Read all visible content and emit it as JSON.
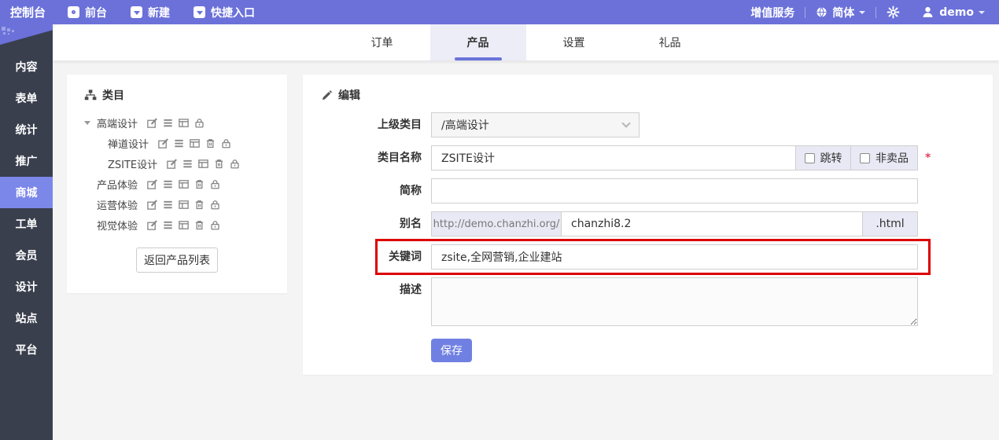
{
  "topbar": {
    "logo": "控制台",
    "nav": [
      {
        "label": "前台",
        "icon": "monitor-icon"
      },
      {
        "label": "新建",
        "icon": "caret-square-icon"
      },
      {
        "label": "快捷入口",
        "icon": "caret-square-icon"
      }
    ],
    "vas": "增值服务",
    "language": "简体",
    "username": "demo"
  },
  "sidebar": {
    "items": [
      {
        "label": "内容"
      },
      {
        "label": "表单"
      },
      {
        "label": "统计"
      },
      {
        "label": "推广"
      },
      {
        "label": "商城",
        "active": true
      },
      {
        "label": "工单"
      },
      {
        "label": "会员"
      },
      {
        "label": "设计"
      },
      {
        "label": "站点"
      },
      {
        "label": "平台"
      }
    ]
  },
  "tabs": {
    "items": [
      {
        "label": "订单"
      },
      {
        "label": "产品",
        "active": true
      },
      {
        "label": "设置"
      },
      {
        "label": "礼品"
      }
    ]
  },
  "category_panel": {
    "title": "类目",
    "back_button": "返回产品列表",
    "tree": [
      {
        "name": "高端设计",
        "level": 0,
        "expanded": true,
        "actions": [
          "edit",
          "list",
          "browse",
          "lock"
        ]
      },
      {
        "name": "禅道设计",
        "level": 1,
        "actions": [
          "edit",
          "list",
          "browse",
          "delete",
          "lock"
        ]
      },
      {
        "name": "ZSITE设计",
        "level": 1,
        "actions": [
          "edit",
          "list",
          "browse",
          "delete",
          "lock"
        ]
      },
      {
        "name": "产品体验",
        "level": 0,
        "actions": [
          "edit",
          "list",
          "browse",
          "delete",
          "lock"
        ]
      },
      {
        "name": "运营体验",
        "level": 0,
        "actions": [
          "edit",
          "list",
          "browse",
          "delete",
          "lock"
        ]
      },
      {
        "name": "视觉体验",
        "level": 0,
        "actions": [
          "edit",
          "list",
          "browse",
          "delete",
          "lock"
        ]
      }
    ]
  },
  "edit_panel": {
    "title": "编辑",
    "save_label": "保存",
    "fields": {
      "parent": {
        "label": "上级类目",
        "value": "/高端设计"
      },
      "name": {
        "label": "类目名称",
        "value": "ZSITE设计",
        "checkbox_redirect": "跳转",
        "checkbox_notforsale": "非卖品",
        "required_mark": "*"
      },
      "shortname": {
        "label": "简称",
        "value": ""
      },
      "alias": {
        "label": "别名",
        "prefix": "http://demo.chanzhi.org/",
        "value": "chanzhi8.2",
        "suffix": ".html"
      },
      "keywords": {
        "label": "关键词",
        "value": "zsite,全网营销,企业建站",
        "highlighted": true
      },
      "description": {
        "label": "描述",
        "value": ""
      }
    }
  },
  "colors": {
    "accent": "#6b71d9",
    "sidebar_bg": "#3a3f4e",
    "sidebar_active": "#7b87e9",
    "tab_active_bg": "#ededf8",
    "annotation": "#dd0000",
    "save_button": "#7080e2"
  }
}
